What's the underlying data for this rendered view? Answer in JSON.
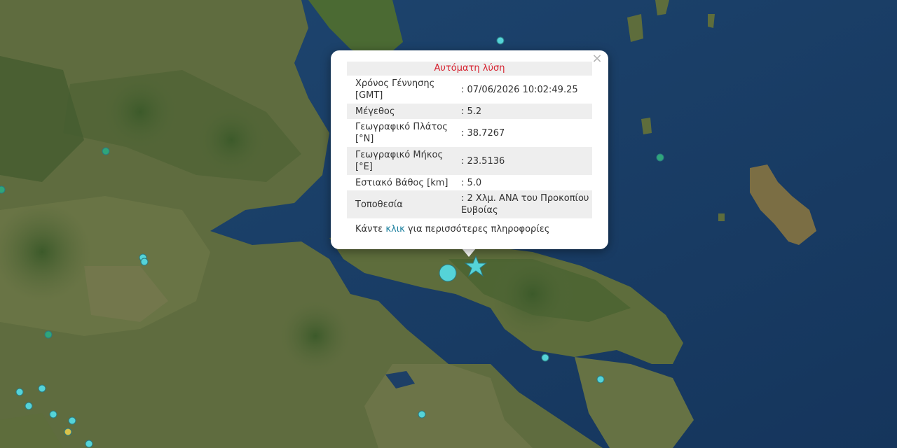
{
  "popup": {
    "title": "Αυτόματη λύση",
    "close_symbol": "×",
    "rows": [
      {
        "label": "Χρόνος Γέννησης [GMT]",
        "value": ": 07/06/2026 10:02:49.25"
      },
      {
        "label": "Μέγεθος",
        "value": ": 5.2"
      },
      {
        "label": "Γεωγραφικό Πλάτος [°N]",
        "value": ": 38.7267"
      },
      {
        "label": "Γεωγραφικό Μήκος [°E]",
        "value": ": 23.5136"
      },
      {
        "label": "Εστιακό Βάθος [km]",
        "value": ": 5.0"
      },
      {
        "label": "Τοποθεσία",
        "value": ": 2 Χλμ. ΑΝΑ του Προκοπίου Ευβοίας"
      }
    ],
    "more_prefix": "Κάντε",
    "more_link": "κλικ",
    "more_suffix": "για περισσότερες πληροφορίες"
  },
  "map": {
    "sea_color": "#173a63",
    "land_color": "#5b6a3c",
    "marker_color": "#55d3d8",
    "epicenter_icon": "star-icon"
  }
}
